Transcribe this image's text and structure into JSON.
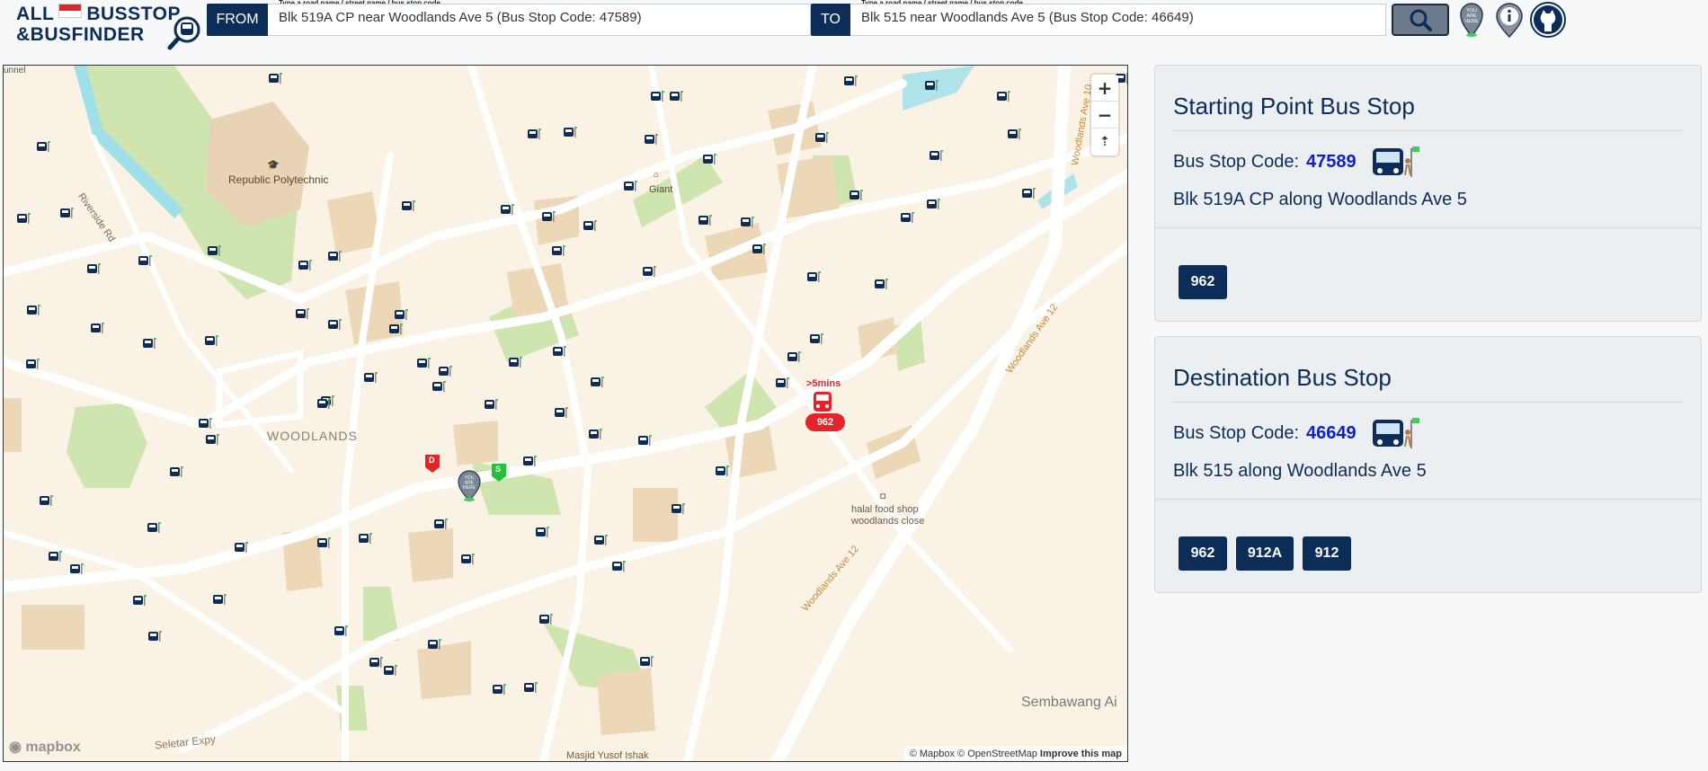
{
  "app": {
    "logo_line1_a": "ALL",
    "logo_line1_b": "BUSSTOP",
    "logo_line2": "&BUSFINDER"
  },
  "route": {
    "from_label": "FROM",
    "to_label": "TO",
    "hint": "Type a road name / street name / bus stop code",
    "from_value": "Blk 519A CP near Woodlands Ave 5 (Bus Stop Code: 47589)",
    "to_value": "Blk 515 near Woodlands Ave 5 (Bus Stop Code: 46649)"
  },
  "header_icons": [
    "search-icon",
    "you-are-here-icon",
    "info-icon",
    "github-icon"
  ],
  "you_are_here": "YOU ARE HERE",
  "map": {
    "labels": {
      "republic_poly": "Republic Polytechnic",
      "woodlands": "WOODLANDS",
      "giant": "Giant",
      "riverside": "Riverside Rd",
      "halal1": "halal food shop",
      "halal2": "woodlands close",
      "ave12a": "Woodlands Ave 12",
      "ave12b": "Woodlands Ave 12",
      "ave10": "Woodlands Ave 10",
      "sembawang": "Sembawang Ai",
      "seletar": "Seletar Expy",
      "masjid": "Masjid Yusof Ishak",
      "tunnel": "unnel"
    },
    "bus_marker": {
      "eta": ">5mins",
      "service": "962"
    },
    "dest_marker": "D",
    "start_marker": "S",
    "zoom_in": "+",
    "zoom_out": "−",
    "compass": "⇡",
    "mapbox": "mapbox",
    "attribution_a": "© Mapbox © OpenStreetMap",
    "attribution_b": "Improve this map"
  },
  "start_panel": {
    "title": "Starting Point Bus Stop",
    "code_label": "Bus Stop Code:",
    "code": "47589",
    "name": "Blk 519A CP along Woodlands Ave 5",
    "services": [
      "962"
    ]
  },
  "dest_panel": {
    "title": "Destination Bus Stop",
    "code_label": "Bus Stop Code:",
    "code": "46649",
    "name": "Blk 515 along Woodlands Ave 5",
    "services": [
      "962",
      "912A",
      "912"
    ]
  },
  "colors": {
    "navy": "#0c2d57",
    "code_blue": "#0b1fd1",
    "eta_red": "#e3242b",
    "map_bg": "#faf2e4"
  }
}
